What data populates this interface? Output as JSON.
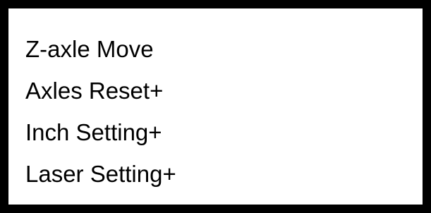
{
  "menu": {
    "items": [
      {
        "label": "Z-axle Move"
      },
      {
        "label": "Axles Reset+"
      },
      {
        "label": "Inch Setting+"
      },
      {
        "label": "Laser Setting+"
      }
    ]
  },
  "colors": {
    "border": "#000000",
    "background": "#ffffff",
    "text": "#000000"
  }
}
